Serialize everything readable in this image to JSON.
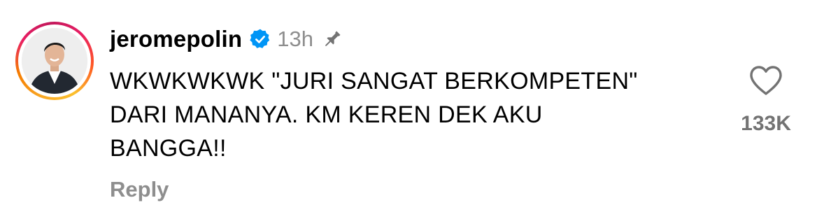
{
  "comment": {
    "username": "jeromepolin",
    "timestamp": "13h",
    "text": "WKWKWKWK \"JURI SANGAT BERKOMPETEN\" DARI MANANYA. KM KEREN DEK AKU BANGGA!!",
    "reply_label": "Reply",
    "like_count": "133K",
    "verified": true,
    "pinned": true
  },
  "icons": {
    "verified": "verified-badge-icon",
    "pin": "pin-icon",
    "like": "heart-outline-icon"
  },
  "colors": {
    "username": "#000000",
    "muted": "#8e8e8e",
    "verified_blue": "#0095f6",
    "like_count": "#737373",
    "story_ring_start": "#f9a825",
    "story_ring_end": "#e91e63"
  }
}
